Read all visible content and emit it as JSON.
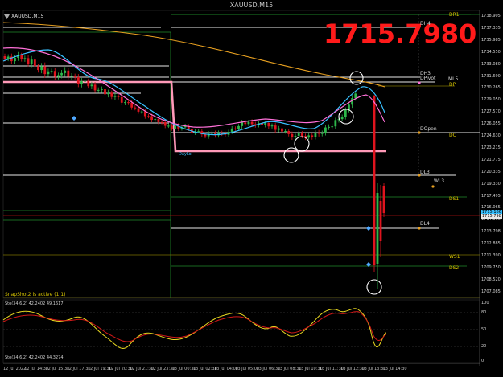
{
  "window": {
    "title": "XAUUSD,M15"
  },
  "chart": {
    "symbol_label": "XAUUSD,M15",
    "price_display": "1715.7980"
  },
  "levels": {
    "dr1": "DR1",
    "dh4": "DH4",
    "dh3": "DH3",
    "dpivot": "DPivot",
    "ml5": "ML5",
    "dp": "DP",
    "dopen": "DOpen",
    "do": "DO",
    "dl3": "DL3",
    "wl3": "WL3",
    "ds1": "DS1",
    "dl4": "DL4",
    "ws1": "WS1",
    "ds2": "DS2",
    "daylo": "DayLo"
  },
  "price_axis": {
    "labels": [
      "1738.905",
      "1737.335",
      "1735.985",
      "1734.550",
      "1733.080",
      "1731.690",
      "1730.265",
      "1729.050",
      "1727.570",
      "1726.055",
      "1724.630",
      "1723.215",
      "1721.775",
      "1720.335",
      "1719.330",
      "1717.495",
      "1716.065",
      "1714.166",
      "1713.798",
      "1712.885",
      "1711.390",
      "1709.750",
      "1708.520",
      "1707.085"
    ],
    "current_ask": "1715.166",
    "current_bid": "1715.798"
  },
  "time_axis": {
    "labels": [
      "12 Jul 2022",
      "12 Jul 14:30",
      "12 Jul 15:30",
      "12 Jul 17:30",
      "12 Jul 19:30",
      "12 Jul 20:30",
      "12 Jul 21:30",
      "12 Jul 23:30",
      "13 Jul 00:30",
      "13 Jul 02:30",
      "13 Jul 04:00",
      "13 Jul 05:00",
      "13 Jul 06:30",
      "13 Jul 08:30",
      "13 Jul 10:30",
      "13 Jul 11:30",
      "13 Jul 12:30",
      "13 Jul 13:30",
      "13 Jul 14:30"
    ]
  },
  "status": {
    "snapshot": "SnapShot2 is active (1,1)"
  },
  "oscillator": {
    "label": "Sto(34,6,2) 42.2402 49.1617",
    "label2": "Sto(34,6,2) 42.2402 44.3274",
    "levels": [
      "100",
      "80",
      "50",
      "20",
      "0"
    ]
  },
  "colors": {
    "background": "#000000",
    "bull": "#2db84b",
    "bear": "#e0141e",
    "ma_fast": "#38c0ff",
    "ma_slow": "#ff70d8",
    "ma_long": "#e8a020",
    "dayrange": "#ff9ab8",
    "green_level": "#1f8a2a",
    "olive_level": "#7a7200",
    "big_price": "#ff1a1a"
  }
}
